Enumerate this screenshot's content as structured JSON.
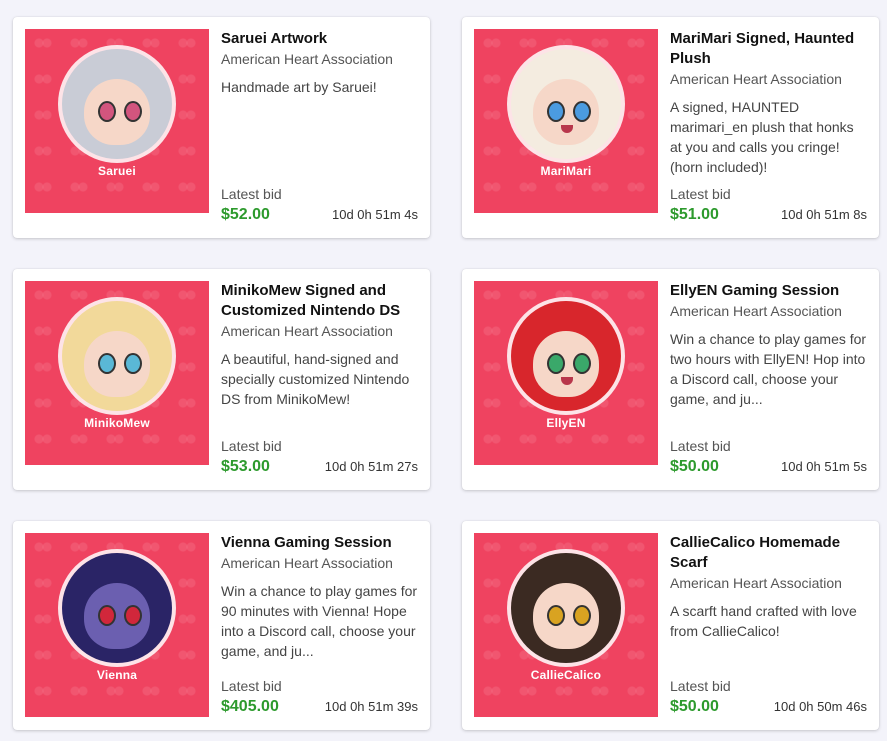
{
  "colors": {
    "thumb_bg": "#ef4360",
    "price": "#2d9a2d",
    "page_bg": "#f3f3fa"
  },
  "auctions": [
    {
      "title": "Saruei Artwork",
      "org": "American Heart Association",
      "desc": "Handmade art by Saruei!",
      "thumb_name": "Saruei",
      "bid_label": "Latest bid",
      "price": "$52.00",
      "timer": "10d 0h 51m 4s",
      "hair_color": "#c9ccd6",
      "eye_color": "#d3557e"
    },
    {
      "title": "MariMari Signed, Haunted Plush",
      "org": "American Heart Association",
      "desc": "A signed, HAUNTED marimari_en plush that honks at you and calls you cringe! (horn included)!",
      "thumb_name": "MariMari",
      "bid_label": "Latest bid",
      "price": "$51.00",
      "timer": "10d 0h 51m 8s",
      "hair_color": "#f4ece0",
      "eye_color": "#4b9be0"
    },
    {
      "title": "MinikoMew Signed and Customized Nintendo DS",
      "org": "American Heart Association",
      "desc": "A beautiful, hand-signed and specially customized Nintendo DS from MinikoMew!",
      "thumb_name": "MinikoMew",
      "bid_label": "Latest bid",
      "price": "$53.00",
      "timer": "10d 0h 51m 27s",
      "hair_color": "#f2d99a",
      "eye_color": "#5ab8d6"
    },
    {
      "title": "EllyEN Gaming Session",
      "org": "American Heart Association",
      "desc": "Win a chance to play games for two hours with EllyEN! Hop into a Discord call, choose your game, and ju...",
      "thumb_name": "EllyEN",
      "bid_label": "Latest bid",
      "price": "$50.00",
      "timer": "10d 0h 51m 5s",
      "hair_color": "#d8262c",
      "eye_color": "#3aa86a"
    },
    {
      "title": "Vienna Gaming Session",
      "org": "American Heart Association",
      "desc": "Win a chance to play games for 90 minutes with Vienna! Hope into a Discord call, choose your game, and ju...",
      "thumb_name": "Vienna",
      "bid_label": "Latest bid",
      "price": "$405.00",
      "timer": "10d 0h 51m 39s",
      "hair_color": "#2a2466",
      "eye_color": "#d1273b"
    },
    {
      "title": "CallieCalico Homemade Scarf",
      "org": "American Heart Association",
      "desc": "A scarft hand crafted with love from CallieCalico!",
      "thumb_name": "CallieCalico",
      "bid_label": "Latest bid",
      "price": "$50.00",
      "timer": "10d 0h 50m 46s",
      "hair_color": "#3b2a22",
      "eye_color": "#d9a321"
    }
  ]
}
